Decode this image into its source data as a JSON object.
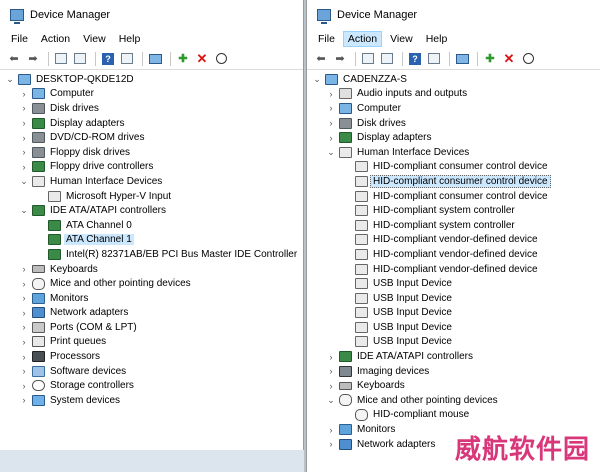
{
  "left": {
    "title": "Device Manager",
    "menu": [
      "File",
      "Action",
      "View",
      "Help"
    ],
    "root": "DESKTOP-QKDE12D",
    "tree": [
      {
        "label": "Computer",
        "icon": "computer-icon",
        "level": 1,
        "chev": "›"
      },
      {
        "label": "Disk drives",
        "icon": "disk-drive-icon",
        "level": 1,
        "chev": "›"
      },
      {
        "label": "Display adapters",
        "icon": "display-adapter-icon",
        "level": 1,
        "chev": "›"
      },
      {
        "label": "DVD/CD-ROM drives",
        "icon": "dvd-drive-icon",
        "level": 1,
        "chev": "›"
      },
      {
        "label": "Floppy disk drives",
        "icon": "floppy-icon",
        "level": 1,
        "chev": "›"
      },
      {
        "label": "Floppy drive controllers",
        "icon": "controller-icon",
        "level": 1,
        "chev": "›"
      },
      {
        "label": "Human Interface Devices",
        "icon": "hid-icon",
        "level": 1,
        "chev": "⌄"
      },
      {
        "label": "Microsoft Hyper-V Input",
        "icon": "hid-icon",
        "level": 2,
        "chev": ""
      },
      {
        "label": "IDE ATA/ATAPI controllers",
        "icon": "ide-controller-icon",
        "level": 1,
        "chev": "⌄"
      },
      {
        "label": "ATA Channel 0",
        "icon": "ide-controller-icon",
        "level": 2,
        "chev": ""
      },
      {
        "label": "ATA Channel 1",
        "icon": "ide-controller-icon",
        "level": 2,
        "chev": "",
        "selected": true
      },
      {
        "label": "Intel(R) 82371AB/EB PCI Bus Master IDE Controller",
        "icon": "ide-controller-icon",
        "level": 2,
        "chev": ""
      },
      {
        "label": "Keyboards",
        "icon": "keyboard-icon",
        "level": 1,
        "chev": "›"
      },
      {
        "label": "Mice and other pointing devices",
        "icon": "mouse-icon",
        "level": 1,
        "chev": "›"
      },
      {
        "label": "Monitors",
        "icon": "monitor-icon",
        "level": 1,
        "chev": "›"
      },
      {
        "label": "Network adapters",
        "icon": "network-adapter-icon",
        "level": 1,
        "chev": "›"
      },
      {
        "label": "Ports (COM & LPT)",
        "icon": "port-icon",
        "level": 1,
        "chev": "›"
      },
      {
        "label": "Print queues",
        "icon": "printer-icon",
        "level": 1,
        "chev": "›"
      },
      {
        "label": "Processors",
        "icon": "processor-icon",
        "level": 1,
        "chev": "›"
      },
      {
        "label": "Software devices",
        "icon": "software-device-icon",
        "level": 1,
        "chev": "›"
      },
      {
        "label": "Storage controllers",
        "icon": "storage-controller-icon",
        "level": 1,
        "chev": "›"
      },
      {
        "label": "System devices",
        "icon": "system-device-icon",
        "level": 1,
        "chev": "›"
      }
    ]
  },
  "right": {
    "title": "Device Manager",
    "menu": [
      "File",
      "Action",
      "View",
      "Help"
    ],
    "active_menu": "Action",
    "root": "CADENZZA-S",
    "tree": [
      {
        "label": "Audio inputs and outputs",
        "icon": "audio-icon",
        "level": 1,
        "chev": "›"
      },
      {
        "label": "Computer",
        "icon": "computer-icon",
        "level": 1,
        "chev": "›"
      },
      {
        "label": "Disk drives",
        "icon": "disk-drive-icon",
        "level": 1,
        "chev": "›"
      },
      {
        "label": "Display adapters",
        "icon": "display-adapter-icon",
        "level": 1,
        "chev": "›"
      },
      {
        "label": "Human Interface Devices",
        "icon": "hid-icon",
        "level": 1,
        "chev": "⌄"
      },
      {
        "label": "HID-compliant consumer control device",
        "icon": "hid-icon",
        "level": 2,
        "chev": ""
      },
      {
        "label": "HID-compliant consumer control device",
        "icon": "hid-icon",
        "level": 2,
        "chev": "",
        "selected": true
      },
      {
        "label": "HID-compliant consumer control device",
        "icon": "hid-icon",
        "level": 2,
        "chev": ""
      },
      {
        "label": "HID-compliant system controller",
        "icon": "hid-icon",
        "level": 2,
        "chev": ""
      },
      {
        "label": "HID-compliant system controller",
        "icon": "hid-icon",
        "level": 2,
        "chev": ""
      },
      {
        "label": "HID-compliant vendor-defined device",
        "icon": "hid-icon",
        "level": 2,
        "chev": ""
      },
      {
        "label": "HID-compliant vendor-defined device",
        "icon": "hid-icon",
        "level": 2,
        "chev": ""
      },
      {
        "label": "HID-compliant vendor-defined device",
        "icon": "hid-icon",
        "level": 2,
        "chev": ""
      },
      {
        "label": "USB Input Device",
        "icon": "hid-icon",
        "level": 2,
        "chev": ""
      },
      {
        "label": "USB Input Device",
        "icon": "hid-icon",
        "level": 2,
        "chev": ""
      },
      {
        "label": "USB Input Device",
        "icon": "hid-icon",
        "level": 2,
        "chev": ""
      },
      {
        "label": "USB Input Device",
        "icon": "hid-icon",
        "level": 2,
        "chev": ""
      },
      {
        "label": "USB Input Device",
        "icon": "hid-icon",
        "level": 2,
        "chev": ""
      },
      {
        "label": "IDE ATA/ATAPI controllers",
        "icon": "ide-controller-icon",
        "level": 1,
        "chev": "›"
      },
      {
        "label": "Imaging devices",
        "icon": "camera-icon",
        "level": 1,
        "chev": "›"
      },
      {
        "label": "Keyboards",
        "icon": "keyboard-icon",
        "level": 1,
        "chev": "›"
      },
      {
        "label": "Mice and other pointing devices",
        "icon": "mouse-icon",
        "level": 1,
        "chev": "⌄"
      },
      {
        "label": "HID-compliant mouse",
        "icon": "mouse-icon",
        "level": 2,
        "chev": ""
      },
      {
        "label": "Monitors",
        "icon": "monitor-icon",
        "level": 1,
        "chev": "›"
      },
      {
        "label": "Network adapters",
        "icon": "network-adapter-icon",
        "level": 1,
        "chev": "›"
      }
    ]
  },
  "watermark": "威航软件园"
}
